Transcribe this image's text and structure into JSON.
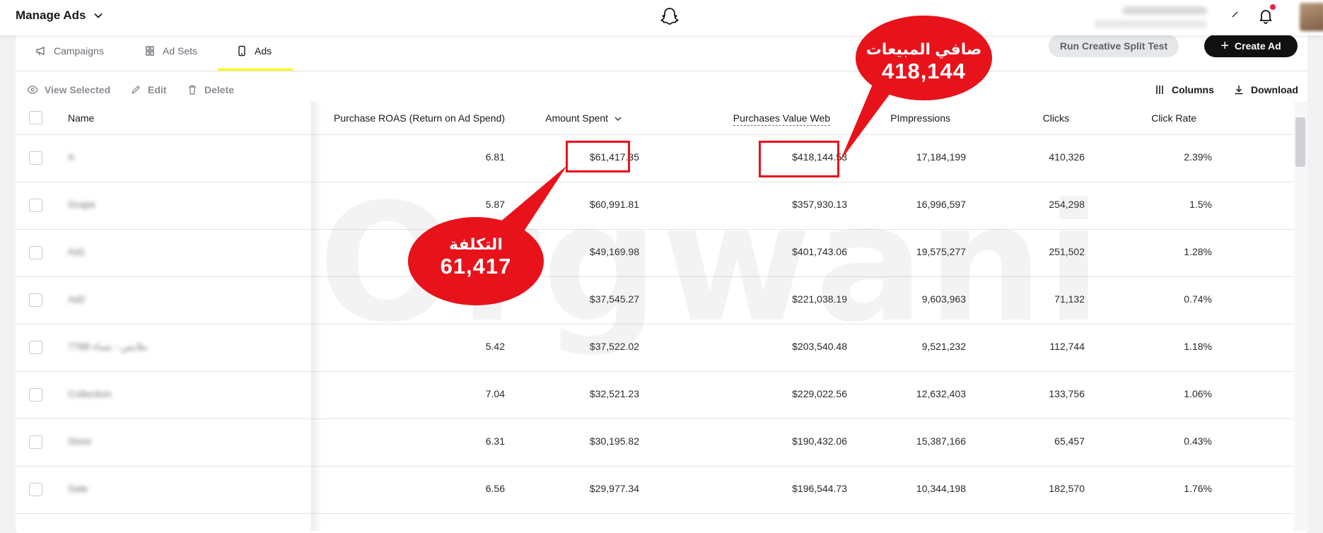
{
  "topbar": {
    "app_title": "Manage Ads"
  },
  "tabs": [
    {
      "label": "Campaigns"
    },
    {
      "label": "Ad Sets"
    },
    {
      "label": "Ads"
    }
  ],
  "actions": {
    "split_test": "Run Creative Split Test",
    "create_ad": "Create Ad"
  },
  "toolbar": {
    "view_selected": "View Selected",
    "edit": "Edit",
    "delete": "Delete",
    "columns": "Columns",
    "download": "Download"
  },
  "table": {
    "headers": {
      "name": "Name",
      "roas": "Purchase ROAS (Return on Ad Spend)",
      "spent": "Amount Spent",
      "purchases_value": "Purchases Value Web",
      "impressions": "Paid Impressions",
      "impressions_visible": "Impressions",
      "clicks": "Clicks",
      "click_rate": "Click Rate"
    },
    "rows": [
      {
        "name": "A",
        "roas": "6.81",
        "spent": "$61,417.35",
        "value": "$418,144.53",
        "impressions": "17,184,199",
        "clicks": "410,326",
        "rate": "2.39%"
      },
      {
        "name": "Grape",
        "roas": "5.87",
        "spent": "$60,991.81",
        "value": "$357,930.13",
        "impressions": "16,996,597",
        "clicks": "254,298",
        "rate": "1.5%"
      },
      {
        "name": "Ad1",
        "roas": "",
        "spent": "$49,169.98",
        "value": "$401,743.06",
        "impressions": "19,575,277",
        "clicks": "251,502",
        "rate": "1.28%"
      },
      {
        "name": "Ad2",
        "roas": "",
        "spent": "$37,545.27",
        "value": "$221,038.19",
        "impressions": "9,603,963",
        "clicks": "71,132",
        "rate": "0.74%"
      },
      {
        "name": "ملابس - نساء 7788",
        "roas": "5.42",
        "spent": "$37,522.02",
        "value": "$203,540.48",
        "impressions": "9,521,232",
        "clicks": "112,744",
        "rate": "1.18%"
      },
      {
        "name": "Collection",
        "roas": "7.04",
        "spent": "$32,521.23",
        "value": "$229,022.56",
        "impressions": "12,632,403",
        "clicks": "133,756",
        "rate": "1.06%"
      },
      {
        "name": "Store",
        "roas": "6.31",
        "spent": "$30,195.82",
        "value": "$190,432.06",
        "impressions": "15,387,166",
        "clicks": "65,457",
        "rate": "0.43%"
      },
      {
        "name": "Sale",
        "roas": "6.56",
        "spent": "$29,977.34",
        "value": "$196,544.73",
        "impressions": "10,344,198",
        "clicks": "182,570",
        "rate": "1.76%"
      }
    ]
  },
  "watermark": "Orgwani",
  "annotations": {
    "sales": {
      "label": "صافي المبيعات",
      "value": "418,144"
    },
    "cost": {
      "label": "التكلفة",
      "value": "61,417"
    }
  },
  "colors": {
    "accent_yellow": "#fffc00",
    "annotation_red": "#e8121b",
    "notification_red": "#e2264d"
  }
}
